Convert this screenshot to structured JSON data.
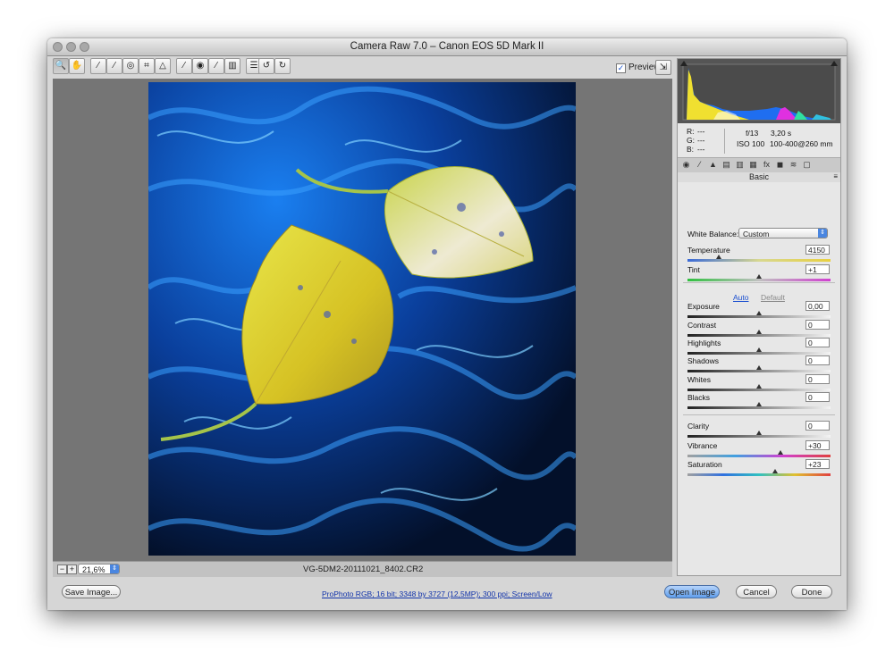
{
  "window": {
    "title": "Camera Raw 7.0  –  Canon EOS 5D Mark II"
  },
  "toolbar": {
    "tools": [
      {
        "name": "zoom-tool-icon",
        "glyph": "🔍"
      },
      {
        "name": "hand-tool-icon",
        "glyph": "✋"
      },
      {
        "name": "white-balance-tool-icon",
        "glyph": "⁄"
      },
      {
        "name": "color-sampler-tool-icon",
        "glyph": "⁄"
      },
      {
        "name": "targeted-adjustment-tool-icon",
        "glyph": "◎"
      },
      {
        "name": "crop-tool-icon",
        "glyph": "⌗"
      },
      {
        "name": "straighten-tool-icon",
        "glyph": "△"
      },
      {
        "name": "spot-removal-tool-icon",
        "glyph": "⁄"
      },
      {
        "name": "red-eye-tool-icon",
        "glyph": "◉"
      },
      {
        "name": "adjustment-brush-icon",
        "glyph": "⁄"
      },
      {
        "name": "graduated-filter-icon",
        "glyph": "▥"
      },
      {
        "name": "preferences-icon",
        "glyph": "☰"
      },
      {
        "name": "rotate-left-icon",
        "glyph": "↺"
      },
      {
        "name": "rotate-right-icon",
        "glyph": "↻"
      }
    ],
    "preview_label": "Preview",
    "preview_checked": true
  },
  "status": {
    "zoom": "21,6%",
    "filename": "VG-5DM2-20111021_8402.CR2"
  },
  "info": {
    "r": "R:",
    "g": "G:",
    "b": "B:",
    "dash": "---",
    "aperture": "f/13",
    "shutter": "3,20 s",
    "iso": "ISO 100",
    "lens": "100-400@260 mm"
  },
  "panel": {
    "title": "Basic",
    "white_balance_label": "White Balance:",
    "white_balance_value": "Custom",
    "auto_label": "Auto",
    "default_label": "Default",
    "sliders": [
      {
        "label": "Temperature",
        "value": "4150",
        "pos": 0.22
      },
      {
        "label": "Tint",
        "value": "+1",
        "pos": 0.5
      },
      {
        "label": "Exposure",
        "value": "0,00",
        "pos": 0.5
      },
      {
        "label": "Contrast",
        "value": "0",
        "pos": 0.5
      },
      {
        "label": "Highlights",
        "value": "0",
        "pos": 0.5
      },
      {
        "label": "Shadows",
        "value": "0",
        "pos": 0.5
      },
      {
        "label": "Whites",
        "value": "0",
        "pos": 0.5
      },
      {
        "label": "Blacks",
        "value": "0",
        "pos": 0.5
      },
      {
        "label": "Clarity",
        "value": "0",
        "pos": 0.5
      },
      {
        "label": "Vibrance",
        "value": "+30",
        "pos": 0.65
      },
      {
        "label": "Saturation",
        "value": "+23",
        "pos": 0.615
      }
    ]
  },
  "bottom": {
    "save_label": "Save Image...",
    "workflow_link": "ProPhoto RGB; 16 bit; 3348 by 3727 (12,5MP); 300 ppi; Screen/Low",
    "open_label": "Open Image",
    "cancel_label": "Cancel",
    "done_label": "Done"
  },
  "colors": {
    "accent": "#4a86e0",
    "canvas": "#757575",
    "water": "#0a5dd8"
  }
}
